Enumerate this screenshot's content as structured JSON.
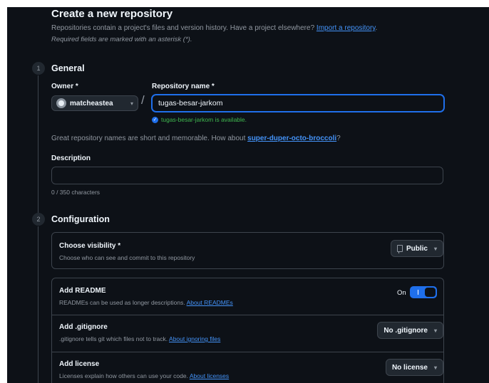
{
  "header": {
    "title": "Create a new repository",
    "subtitle_prefix": "Repositories contain a project's files and version history. Have a project elsewhere? ",
    "import_link": "Import a repository",
    "subtitle_suffix": ".",
    "required_note": "Required fields are marked with an asterisk (*)."
  },
  "general": {
    "step": "1",
    "title": "General",
    "owner_label": "Owner *",
    "owner_value": "matcheastea",
    "separator": "/",
    "repo_label": "Repository name *",
    "repo_value": "tugas-besar-jarkom",
    "availability": "tugas-besar-jarkom is available.",
    "hint_prefix": "Great repository names are short and memorable. How about ",
    "hint_suggestion": "super-duper-octo-broccoli",
    "hint_suffix": "?",
    "description_label": "Description",
    "description_value": "",
    "char_count": "0 / 350 characters"
  },
  "configuration": {
    "step": "2",
    "title": "Configuration",
    "visibility": {
      "title": "Choose visibility *",
      "desc": "Choose who can see and commit to this repository",
      "value": "Public"
    },
    "readme": {
      "title": "Add README",
      "desc": "READMEs can be used as longer descriptions. ",
      "link": "About READMEs",
      "state_label": "On"
    },
    "gitignore": {
      "title": "Add .gitignore",
      "desc": ".gitignore tells git which files not to track. ",
      "link": "About ignoring files",
      "value": "No .gitignore"
    },
    "license": {
      "title": "Add license",
      "desc": "Licenses explain how others can use your code. ",
      "link": "About licenses",
      "value": "No license"
    }
  },
  "colors": {
    "background": "#0d1117",
    "accent": "#1f6feb",
    "link": "#4493f8",
    "success": "#3fb950",
    "border": "#3d444d"
  }
}
